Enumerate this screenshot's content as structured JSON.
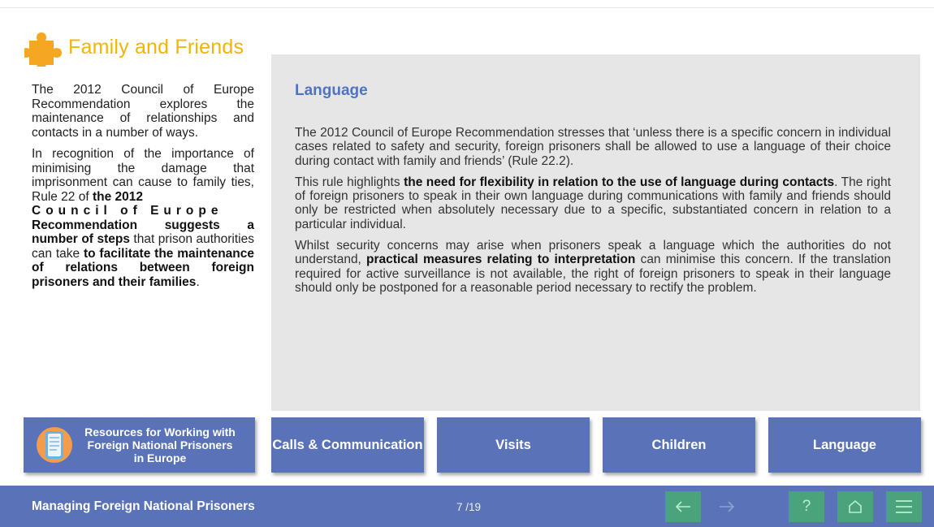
{
  "title": "Family and Friends",
  "left": {
    "para1": "The 2012 Council of Europe Recommendation explores the maintenance of relationships and contacts in a number of ways.",
    "p2_a": "In recognition of the importance of minimising the damage that imprisonment can cause to family ties, Rule 22 of ",
    "p2_b1": "the 2012",
    "p2_b2": "Council of Europe",
    "p2_b3": "Recommendation suggests a number of steps",
    "p2_c": " that prison authorities can take ",
    "p2_d": "to facilitate the maintenance of relations between foreign prisoners and their families",
    "p2_e": "."
  },
  "panel": {
    "heading": "Language",
    "p1": "The 2012 Council of Europe Recommendation stresses that ‘unless there is a specific concern in individual cases related to safety and security, foreign prisoners shall be allowed to use a language of their choice during contact with family and friends’ (Rule 22.2).",
    "p2_a": "This rule highlights ",
    "p2_b": "the need for flexibility in relation to the use of language during contacts",
    "p2_c": ". The right of foreign prisoners to speak in their own language during communications with family and friends should only be restricted when absolutely necessary due to a specific, substantiated concern in relation to a particular individual.",
    "p3_a": "Whilst security concerns may arise when prisoners speak a language which the authorities do not understand, ",
    "p3_b": "practical measures relating to interpretation",
    "p3_c": " can minimise this concern. If the translation required for active surveillance is not available, the right of foreign prisoners to speak in their language should only be postponed for a reasonable period necessary to rectify the problem."
  },
  "nav": {
    "resources": "Resources for Working with Foreign National Prisoners in Europe",
    "calls": "Calls & Communication",
    "visits": "Visits",
    "children": "Children",
    "language": "Language"
  },
  "footer": {
    "title": "Managing Foreign National Prisoners",
    "page": "7 /19",
    "help": "?"
  },
  "icons": {
    "title": "puzzle-icon",
    "resources": "document-icon",
    "back": "arrow-left-icon",
    "next": "arrow-right-icon",
    "help": "question-icon",
    "home": "home-icon",
    "menu": "hamburger-menu-icon"
  },
  "colors": {
    "accent": "#f2b500",
    "heading": "#4f73c4",
    "nav": "#5a73b8",
    "footer_button": "#4aa37a",
    "panel": "#e6e6e6"
  }
}
